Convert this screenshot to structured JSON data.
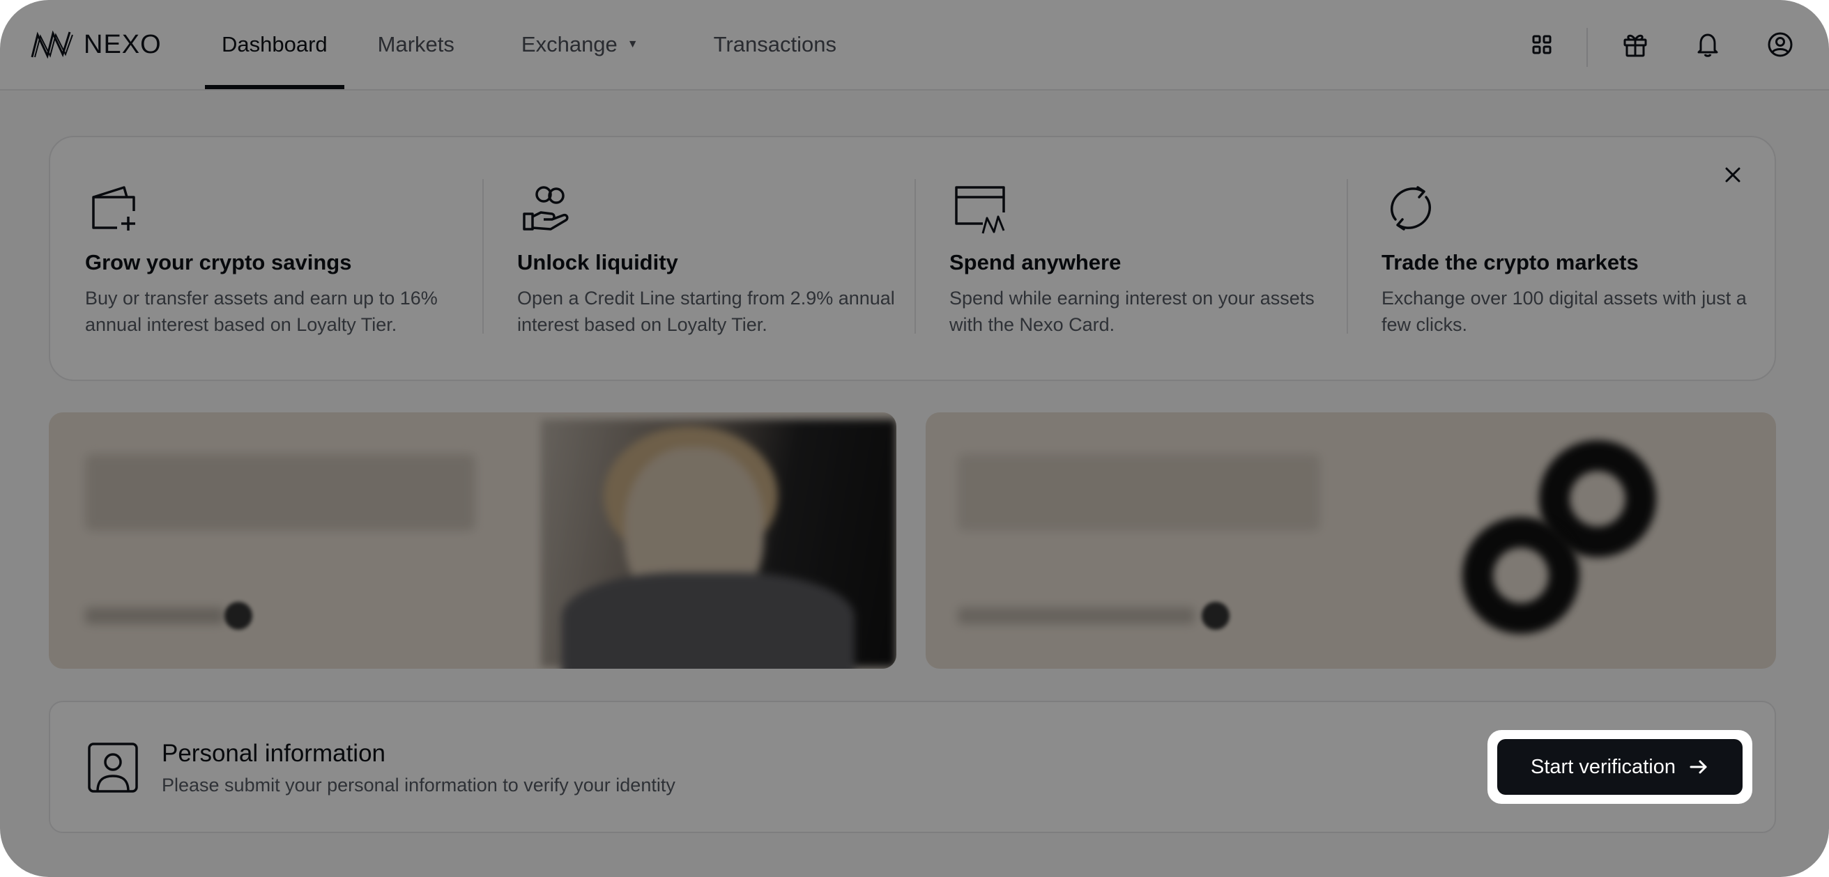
{
  "brand": {
    "name": "NEXO"
  },
  "nav": {
    "items": [
      {
        "label": "Dashboard",
        "active": true
      },
      {
        "label": "Markets"
      },
      {
        "label": "Exchange",
        "has_dropdown": true
      },
      {
        "label": "Transactions"
      }
    ]
  },
  "header_icons": [
    "grid-icon",
    "gift-icon",
    "bell-icon",
    "user-circle-icon"
  ],
  "features": [
    {
      "icon": "wallet-plus-icon",
      "title": "Grow your crypto savings",
      "text": "Buy or transfer assets and earn up to 16% annual interest based on Loyalty Tier."
    },
    {
      "icon": "hand-coins-icon",
      "title": "Unlock liquidity",
      "text": "Open a Credit Line starting from 2.9% annual interest based on Loyalty Tier."
    },
    {
      "icon": "card-icon",
      "title": "Spend anywhere",
      "text": "Spend while earning interest on your assets with the Nexo Card."
    },
    {
      "icon": "refresh-icon",
      "title": "Trade the crypto markets",
      "text": "Exchange over 100 digital assets with just a few clicks."
    }
  ],
  "personal_info": {
    "title": "Personal information",
    "subtitle": "Please submit your personal information to verify your identity",
    "button_label": "Start verification"
  },
  "colors": {
    "overlay": "rgba(0,0,0,0.45)",
    "primary": "#0e1116"
  }
}
